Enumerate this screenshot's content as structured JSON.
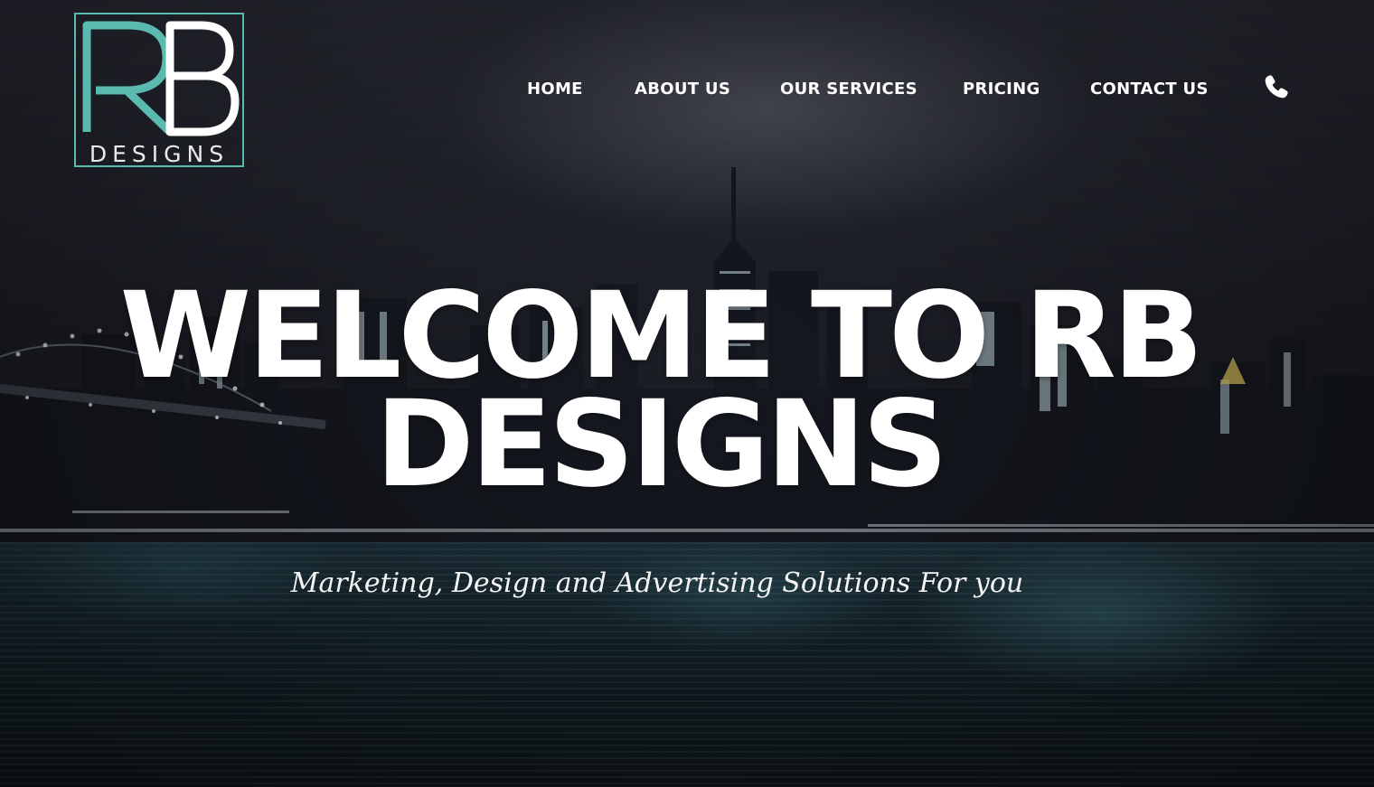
{
  "brand": {
    "logo_letters": "RB",
    "logo_subtitle": "DESIGNS",
    "accent_color": "#5bbab0"
  },
  "nav": {
    "items": [
      {
        "label": "HOME"
      },
      {
        "label": "ABOUT US"
      },
      {
        "label": "OUR SERVICES"
      },
      {
        "label": "PRICING"
      },
      {
        "label": "CONTACT US"
      }
    ],
    "phone_icon": "phone-icon"
  },
  "hero": {
    "title_line1": "WELCOME TO RB",
    "title_line2": "DESIGNS",
    "subtitle": "Marketing, Design and Advertising Solutions For you",
    "background": "night-city-skyline-over-water"
  }
}
